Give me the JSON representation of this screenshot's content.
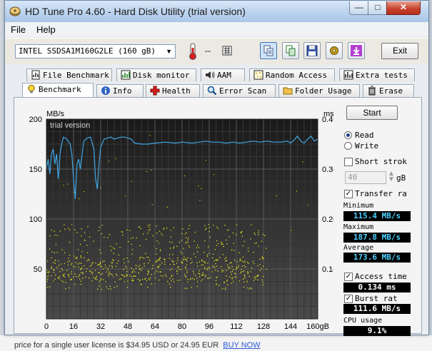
{
  "window": {
    "title": "HD Tune Pro 4.60 - Hard Disk Utility (trial version)"
  },
  "menu": [
    {
      "label": "File"
    },
    {
      "label": "Help"
    }
  ],
  "toolbar": {
    "drive": "INTEL SSDSA1M160G2LE (160 gB)",
    "temperature": "--",
    "exit_label": "Exit"
  },
  "tabs_row1": [
    {
      "label": "File Benchmark",
      "icon": "file-benchmark-icon"
    },
    {
      "label": "Disk monitor",
      "icon": "disk-monitor-icon"
    },
    {
      "label": "AAM",
      "icon": "speaker-icon"
    },
    {
      "label": "Random Access",
      "icon": "random-access-icon"
    },
    {
      "label": "Extra tests",
      "icon": "extra-tests-icon"
    }
  ],
  "tabs_row2": [
    {
      "label": "Benchmark",
      "icon": "bulb-icon",
      "active": true
    },
    {
      "label": "Info",
      "icon": "info-icon"
    },
    {
      "label": "Health",
      "icon": "health-cross-icon"
    },
    {
      "label": "Error Scan",
      "icon": "magnifier-icon"
    },
    {
      "label": "Folder Usage",
      "icon": "folder-icon"
    },
    {
      "label": "Erase",
      "icon": "trash-icon"
    }
  ],
  "controls": {
    "start_label": "Start",
    "read_label": "Read",
    "write_label": "Write",
    "mode": "read",
    "short_stroke_label": "Short strok",
    "short_stroke_checked": false,
    "short_stroke_value": "40",
    "short_stroke_unit": "gB",
    "transfer_label": "Transfer ra",
    "transfer_checked": true,
    "minimum_label": "Minimum",
    "minimum_value": "115.4 MB/s",
    "maximum_label": "Maximum",
    "maximum_value": "187.8 MB/s",
    "average_label": "Average",
    "average_value": "173.6 MB/s",
    "access_label": "Access time",
    "access_checked": true,
    "access_value": "0.134 ms",
    "burst_label": "Burst rat",
    "burst_checked": true,
    "burst_value": "111.6 MB/s",
    "cpu_label": "CPU usage",
    "cpu_value": "9.1%"
  },
  "background": {
    "footer_text": "price for a single user license is $34.95 USD or 24.95 EUR",
    "footer_link": "BUY NOW"
  },
  "chart_data": {
    "type": "line",
    "watermark": "trial version",
    "x_unit": "gB",
    "y_left_unit": "MB/s",
    "y_right_unit": "ms",
    "x_ticks": [
      0,
      16,
      32,
      48,
      64,
      80,
      96,
      112,
      128,
      144,
      160
    ],
    "y_left_ticks": [
      50,
      100,
      150,
      200
    ],
    "y_right_ticks": [
      "0.10",
      "0.20",
      "0.30",
      "0.40"
    ],
    "xlim": [
      0,
      160
    ],
    "ylim_left": [
      0,
      200
    ],
    "ylim_right": [
      0,
      0.4
    ],
    "grid": true,
    "transfer_rate": {
      "x": [
        0,
        1,
        2,
        3,
        4,
        5,
        6,
        7,
        8,
        9,
        10,
        12,
        14,
        15,
        16,
        17,
        18,
        19,
        20,
        22,
        24,
        26,
        28,
        29,
        30,
        31,
        32,
        34,
        36,
        38,
        40,
        42,
        44,
        46,
        48,
        50,
        52,
        56,
        60,
        64,
        70,
        76,
        80,
        86,
        90,
        94,
        98,
        102,
        106,
        110,
        114,
        118,
        122,
        126,
        130,
        134,
        138,
        142,
        144,
        146,
        148,
        150,
        152,
        154,
        156,
        158,
        160
      ],
      "y": [
        150,
        160,
        145,
        165,
        170,
        155,
        165,
        140,
        165,
        175,
        182,
        180,
        175,
        165,
        140,
        120,
        155,
        160,
        150,
        178,
        181,
        182,
        170,
        140,
        130,
        155,
        172,
        180,
        181,
        182,
        180,
        181,
        182,
        182,
        181,
        180,
        176,
        175,
        175,
        176,
        177,
        176,
        177,
        176,
        177,
        178,
        177,
        177,
        176,
        177,
        176,
        177,
        178,
        177,
        178,
        177,
        177,
        178,
        176,
        179,
        183,
        178,
        176,
        180,
        183,
        178,
        180
      ]
    },
    "access_time": {
      "range_ms": [
        0.06,
        0.19
      ],
      "point_count": 700
    }
  }
}
